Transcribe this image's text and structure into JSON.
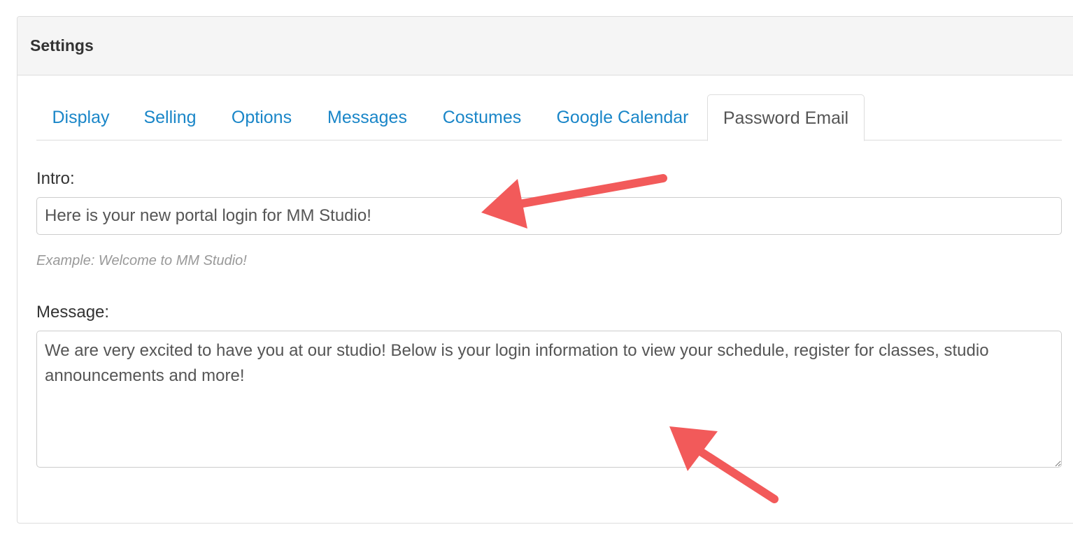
{
  "panel": {
    "title": "Settings"
  },
  "tabs": [
    {
      "label": "Display"
    },
    {
      "label": "Selling"
    },
    {
      "label": "Options"
    },
    {
      "label": "Messages"
    },
    {
      "label": "Costumes"
    },
    {
      "label": "Google Calendar"
    },
    {
      "label": "Password Email",
      "active": true
    }
  ],
  "intro": {
    "label": "Intro:",
    "value": "Here is your new portal login for MM Studio!",
    "help": "Example: Welcome to MM Studio!"
  },
  "message": {
    "label": "Message:",
    "value": "We are very excited to have you at our studio! Below is your login information to view your schedule, register for classes, studio announcements and more!"
  },
  "annotation": {
    "arrow_color": "#f25a5a"
  },
  "colors": {
    "link": "#1a86c8",
    "active_tab_text": "#555555",
    "heading_bg": "#f5f5f5"
  }
}
